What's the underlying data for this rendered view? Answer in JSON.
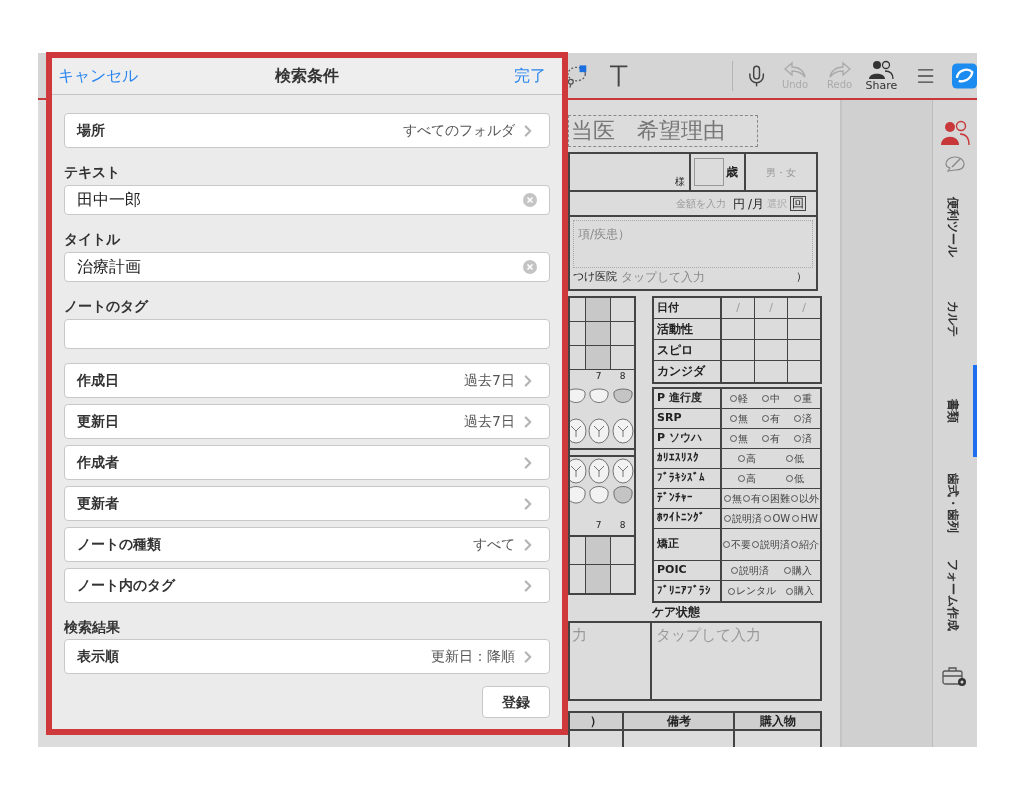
{
  "toolbar": {
    "items": [
      {
        "kind": "lasso"
      },
      {
        "kind": "text"
      },
      {
        "kind": "divider"
      },
      {
        "kind": "mic"
      },
      {
        "kind": "undo",
        "label": "Undo",
        "disabled": true
      },
      {
        "kind": "redo",
        "label": "Redo",
        "disabled": true
      },
      {
        "kind": "share",
        "label": "Share",
        "disabled": false
      },
      {
        "kind": "menu"
      },
      {
        "kind": "logo"
      }
    ]
  },
  "document": {
    "title": "当医　希望理由",
    "patient": {
      "suffix": "様",
      "age_unit": "歳",
      "sex": "男・女"
    },
    "fee": {
      "placeholder": "金額を入力",
      "unit": "円",
      "per": "/月",
      "select": "選択",
      "times": "回"
    },
    "notes": {
      "label": "項/疾患）",
      "clinic": "つけ医院",
      "clinic_placeholder": "タップして入力",
      "close": "）"
    },
    "upper_tooth_numbers": [
      "7",
      "8"
    ],
    "lower_tooth_numbers": [
      "7",
      "8"
    ],
    "checks": {
      "date_label": "日付",
      "date_marks": [
        "/",
        "/",
        "/"
      ],
      "rows": [
        "活動性",
        "スピロ",
        "カンジダ"
      ]
    },
    "assessment": [
      {
        "label": "P 進行度",
        "options": [
          "軽",
          "中",
          "重"
        ],
        "tall": false
      },
      {
        "label": "SRP",
        "options": [
          "無",
          "有",
          "済"
        ],
        "tall": false
      },
      {
        "label": "P ソウハ",
        "options": [
          "無",
          "有",
          "済"
        ],
        "tall": false
      },
      {
        "label": "ｶﾘｴｽﾘｽｸ",
        "options": [
          "高",
          "低"
        ],
        "tall": false
      },
      {
        "label": "ﾌﾞﾗｷｼｽﾞﾑ",
        "options": [
          "高",
          "低"
        ],
        "tall": false
      },
      {
        "label": "ﾃﾞﾝﾁｬｰ",
        "options": [
          "無",
          "有",
          "困難",
          "以外"
        ],
        "tall": false
      },
      {
        "label": "ﾎﾜｲﾄﾆﾝｸﾞ",
        "options": [
          "説明済",
          "OW",
          "HW"
        ],
        "tall": false
      },
      {
        "label": "矯正",
        "options": [
          "不要",
          "説明済",
          "紹介"
        ],
        "tall": true
      },
      {
        "label": "POIC",
        "options": [
          "説明済",
          "購入"
        ],
        "tall": false
      },
      {
        "label": "ﾌﾞﾘﾆｱﾌﾞﾗｼ",
        "options": [
          "レンタル",
          "購入"
        ],
        "tall": false
      }
    ],
    "care": {
      "label": "ケア状態",
      "left": "力",
      "right_placeholder": "タップして入力"
    },
    "bottom_columns": [
      "）",
      "備考",
      "購入物"
    ]
  },
  "sidebar": {
    "tabs": [
      {
        "label": "便利ツール",
        "selected": false
      },
      {
        "label": "カルテ",
        "selected": false
      },
      {
        "label": "書類",
        "selected": true
      },
      {
        "label": "歯式・歯列",
        "selected": false
      },
      {
        "label": "フォーム作成",
        "selected": false
      }
    ]
  },
  "search_panel": {
    "cancel": "キャンセル",
    "title": "検索条件",
    "done": "完了",
    "items": [
      {
        "kind": "row",
        "label": "場所",
        "value": "すべてのフォルダ"
      },
      {
        "kind": "field",
        "label": "テキスト",
        "value": "田中一郎"
      },
      {
        "kind": "field",
        "label": "タイトル",
        "value": "治療計画"
      },
      {
        "kind": "field",
        "label": "ノートのタグ"
      },
      {
        "kind": "row",
        "label": "作成日",
        "value": "過去7日"
      },
      {
        "kind": "row",
        "label": "更新日",
        "value": "過去7日"
      },
      {
        "kind": "row",
        "label": "作成者"
      },
      {
        "kind": "row",
        "label": "更新者"
      },
      {
        "kind": "row",
        "label": "ノートの種類",
        "value": "すべて"
      },
      {
        "kind": "row",
        "label": "ノート内のタグ"
      },
      {
        "kind": "heading",
        "label": "検索結果"
      },
      {
        "kind": "row",
        "label": "表示順",
        "value": "更新日：降順"
      }
    ],
    "submit": "登録"
  }
}
